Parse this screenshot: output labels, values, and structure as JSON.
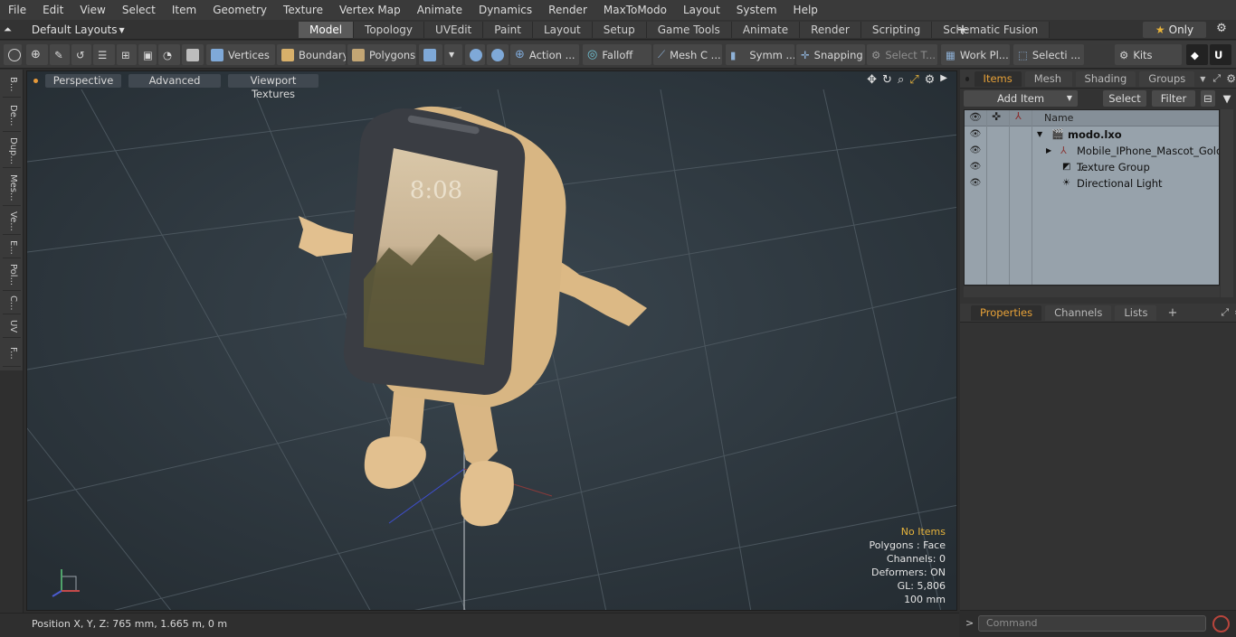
{
  "menubar": [
    "File",
    "Edit",
    "View",
    "Select",
    "Item",
    "Geometry",
    "Texture",
    "Vertex Map",
    "Animate",
    "Dynamics",
    "Render",
    "MaxToModo",
    "Layout",
    "System",
    "Help"
  ],
  "layout": {
    "label": "Default Layouts"
  },
  "tabs": [
    "Model",
    "Topology",
    "UVEdit",
    "Paint",
    "Layout",
    "Setup",
    "Game Tools",
    "Animate",
    "Render",
    "Scripting",
    "Schematic Fusion"
  ],
  "active_tab": "Model",
  "only_label": "Only",
  "toolbar": {
    "vertices": "Vertices",
    "boundary": "Boundary",
    "polygons": "Polygons",
    "action": "Action ...",
    "falloff": "Falloff",
    "meshc": "Mesh C ...",
    "symm": "Symm ...",
    "snapping": "Snapping",
    "selectt": "Select T...",
    "workpl": "Work Pl...",
    "selecti": "Selecti ...",
    "kits": "Kits"
  },
  "left_tabs": [
    "B...",
    "De...",
    "Dup...",
    "Mes...",
    "Ve...",
    "E...",
    "Pol...",
    "C...",
    "UV",
    "F..."
  ],
  "viewport": {
    "view_mode": "Perspective",
    "advanced": "Advanced",
    "textures": "Viewport Textures",
    "info": {
      "no_items": "No Items",
      "polygons": "Polygons : Face",
      "channels": "Channels: 0",
      "deformers": "Deformers: ON",
      "gl": "GL: 5,806",
      "scale": "100 mm"
    },
    "phone_time": "8:08"
  },
  "status": {
    "position": "Position X, Y, Z:   765 mm, 1.665 m, 0 m"
  },
  "panel": {
    "top_tabs": [
      "Items",
      "Mesh ...",
      "Shading",
      "Groups"
    ],
    "add_item": "Add Item",
    "select": "Select",
    "filter": "Filter",
    "name_col": "Name",
    "tree": [
      {
        "label": "modo.lxo",
        "bold": true
      },
      {
        "label": "Mobile_IPhone_Mascot_Gold ...",
        "bold": false
      },
      {
        "label": "Texture Group",
        "bold": false
      },
      {
        "label": "Directional Light",
        "bold": false
      }
    ],
    "bottom_tabs": [
      "Properties",
      "Channels",
      "Lists"
    ],
    "command_placeholder": "Command"
  },
  "colors": {
    "accent": "#e8a238",
    "viewport_bg": "#2f3840",
    "tree_bg": "#97a2ab",
    "mascot": "#e2c08f"
  }
}
